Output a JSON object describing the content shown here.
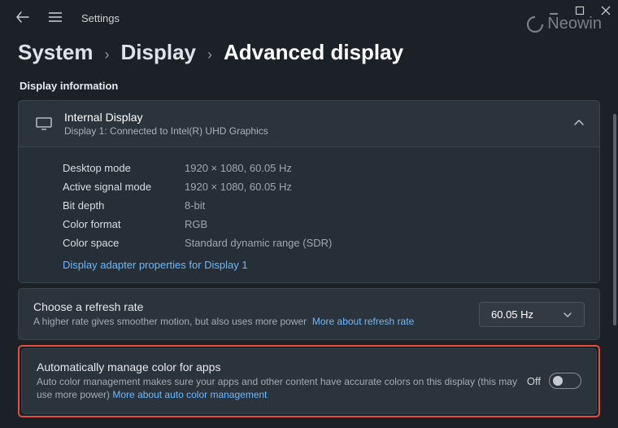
{
  "titlebar": {
    "label": "Settings"
  },
  "watermark": "Neowin",
  "breadcrumb": {
    "items": [
      "System",
      "Display",
      "Advanced display"
    ]
  },
  "section_header": "Display information",
  "display_card": {
    "title": "Internal Display",
    "subtitle": "Display 1: Connected to Intel(R) UHD Graphics",
    "props": [
      {
        "label": "Desktop mode",
        "value": "1920 × 1080, 60.05 Hz"
      },
      {
        "label": "Active signal mode",
        "value": "1920 × 1080, 60.05 Hz"
      },
      {
        "label": "Bit depth",
        "value": "8-bit"
      },
      {
        "label": "Color format",
        "value": "RGB"
      },
      {
        "label": "Color space",
        "value": "Standard dynamic range (SDR)"
      }
    ],
    "adapter_link": "Display adapter properties for Display 1"
  },
  "refresh": {
    "title": "Choose a refresh rate",
    "desc": "A higher rate gives smoother motion, but also uses more power",
    "link": "More about refresh rate",
    "selected": "60.05 Hz"
  },
  "auto_color": {
    "title": "Automatically manage color for apps",
    "desc": "Auto color management makes sure your apps and other content have accurate colors on this display (this may use more power)",
    "link": "More about auto color management",
    "state_label": "Off"
  }
}
